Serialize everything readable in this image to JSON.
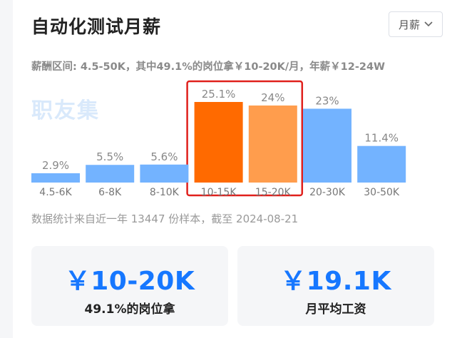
{
  "header": {
    "title": "自动化测试月薪",
    "dropdown_selected": "月薪",
    "dropdown_icon": "chevron-down-icon"
  },
  "summary": "薪酬区间: 4.5-50K，其中49.1%的岗位拿￥10-20K/月，年薪￥12-24W",
  "watermark": "职友集",
  "colors": {
    "bar_default": "#73b3ff",
    "bar_highlight_primary": "#ff6a00",
    "bar_highlight_secondary": "#ff9d4d",
    "highlight_box": "#e0201c",
    "accent_blue": "#1677ff"
  },
  "chart_data": {
    "type": "bar",
    "categories": [
      "4.5-6K",
      "6-8K",
      "8-10K",
      "10-15K",
      "15-20K",
      "20-30K",
      "30-50K"
    ],
    "values": [
      2.9,
      5.5,
      5.6,
      25.1,
      24,
      23,
      11.4
    ],
    "value_labels": [
      "2.9%",
      "5.5%",
      "5.6%",
      "25.1%",
      "24%",
      "23%",
      "11.4%"
    ],
    "unit": "%",
    "highlighted_categories": [
      "10-15K",
      "15-20K"
    ],
    "ylim": [
      0,
      25.1
    ],
    "grid": false,
    "legend": "none"
  },
  "footnote": "数据统计来自近一年 13447 份样本，截至 2024-08-21",
  "cards": [
    {
      "value": "￥10-20K",
      "label": "49.1%的岗位拿"
    },
    {
      "value": "￥19.1K",
      "label": "月平均工资"
    }
  ]
}
